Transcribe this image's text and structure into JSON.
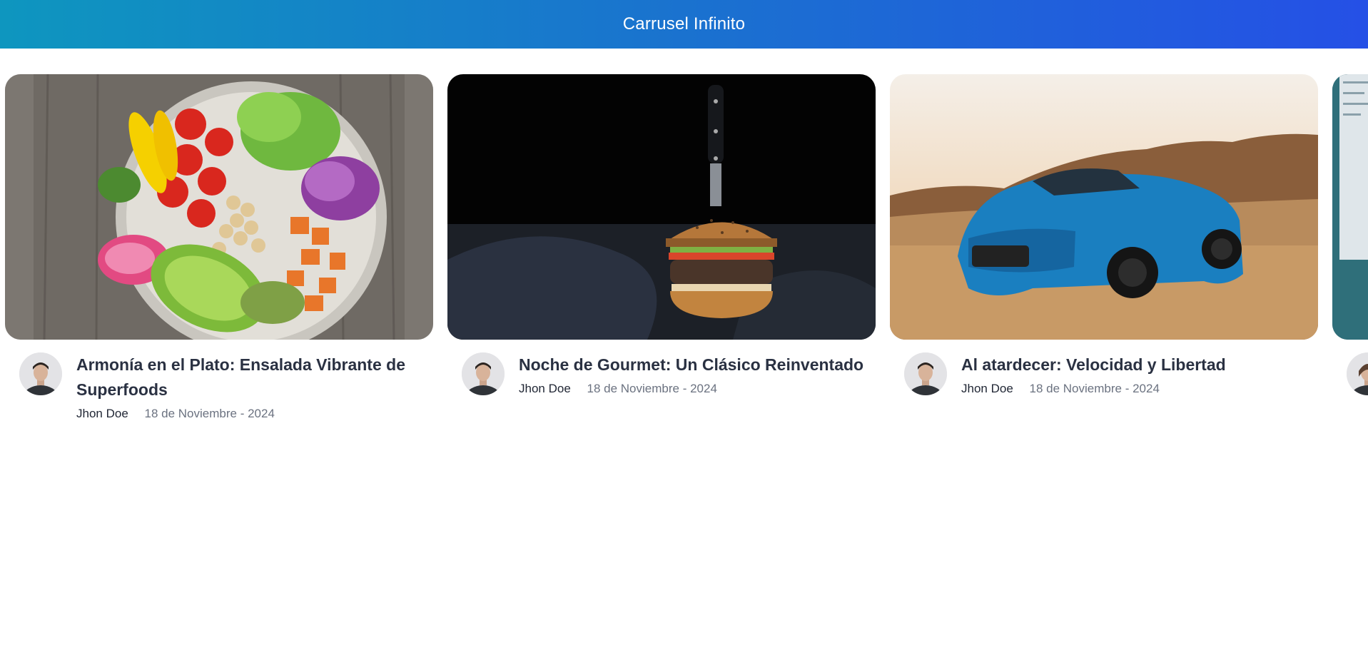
{
  "header": {
    "title": "Carrusel Infinito"
  },
  "cards": [
    {
      "title": "Armonía en el Plato: Ensalada Vibrante de Superfoods",
      "author": "Jhon Doe",
      "date": "18 de Noviembre - 2024",
      "image": "salad-bowl-photo"
    },
    {
      "title": "Noche de Gourmet: Un Clásico Reinventado",
      "author": "Jhon Doe",
      "date": "18 de Noviembre - 2024",
      "image": "burger-with-knife-photo"
    },
    {
      "title": "Al atardecer: Velocidad y Libertad",
      "author": "Jhon Doe",
      "date": "18 de Noviembre - 2024",
      "image": "blue-sports-car-desert-photo"
    },
    {
      "title": "",
      "author": "",
      "date": "",
      "image": "laptop-screen-photo"
    }
  ],
  "colors": {
    "header_start": "#0e96bf",
    "header_end": "#2550e6",
    "title_text": "#2a3142",
    "date_text": "#6b7280"
  }
}
